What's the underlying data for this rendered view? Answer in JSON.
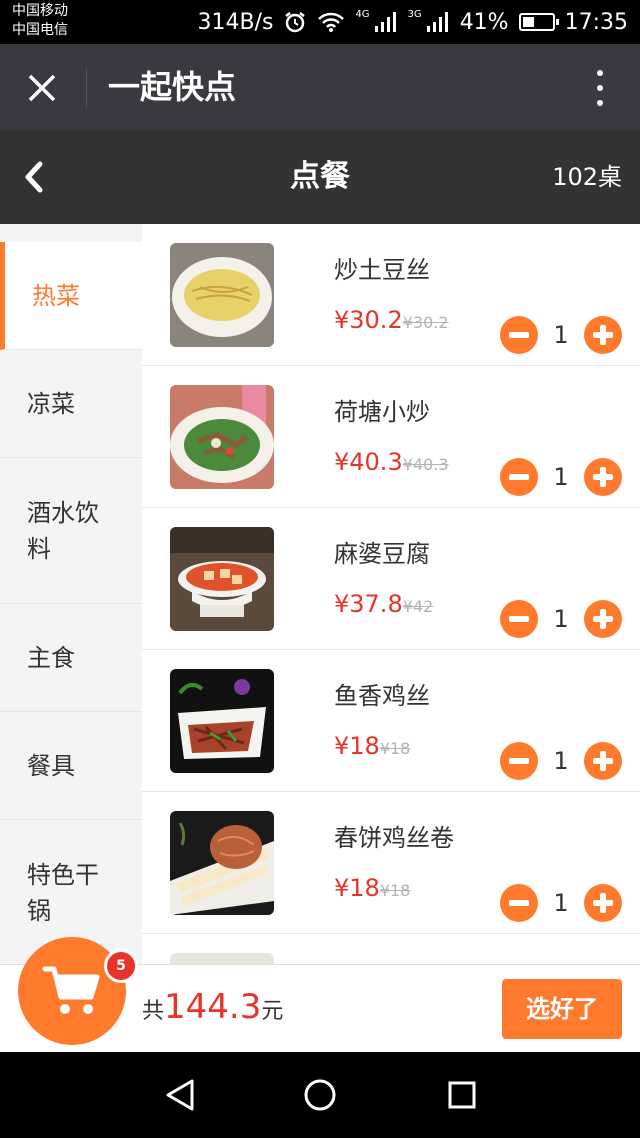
{
  "status_bar": {
    "carrier_1": "中国移动",
    "carrier_2": "中国电信",
    "speed": "314B/s",
    "net_1": "4G",
    "net_2": "3G",
    "battery": "41%",
    "battery_level": 0.41,
    "time": "17:35"
  },
  "titlebar": {
    "title": "一起快点",
    "icons": [
      "close-icon",
      "more-icon"
    ]
  },
  "header": {
    "title": "点餐",
    "table": "102桌",
    "icons": [
      "back-icon"
    ]
  },
  "categories": [
    {
      "label": "热菜",
      "active": true
    },
    {
      "label": "凉菜",
      "active": false
    },
    {
      "label": "酒水饮料",
      "active": false
    },
    {
      "label": "主食",
      "active": false
    },
    {
      "label": "餐具",
      "active": false
    },
    {
      "label": "特色干锅",
      "active": false
    }
  ],
  "dishes": [
    {
      "name": "炒土豆丝",
      "price": "¥30.2",
      "original_price": "¥30.2",
      "qty": "1"
    },
    {
      "name": "荷塘小炒",
      "price": "¥40.3",
      "original_price": "¥40.3",
      "qty": "1"
    },
    {
      "name": "麻婆豆腐",
      "price": "¥37.8",
      "original_price": "¥42",
      "qty": "1"
    },
    {
      "name": "鱼香鸡丝",
      "price": "¥18",
      "original_price": "¥18",
      "qty": "1"
    },
    {
      "name": "春饼鸡丝卷",
      "price": "¥18",
      "original_price": "¥18",
      "qty": "1"
    }
  ],
  "cart": {
    "badge": "5",
    "total_prefix": "共",
    "total": "144.3",
    "total_suffix": "元",
    "confirm": "选好了",
    "icons": [
      "cart-icon"
    ]
  },
  "nav": {
    "icons": [
      "back-triangle-icon",
      "home-circle-icon",
      "recents-square-icon"
    ]
  },
  "colors": {
    "accent": "#ff7a2c",
    "price": "#e8332a",
    "titlebar": "#393a3f",
    "header": "#333333"
  }
}
